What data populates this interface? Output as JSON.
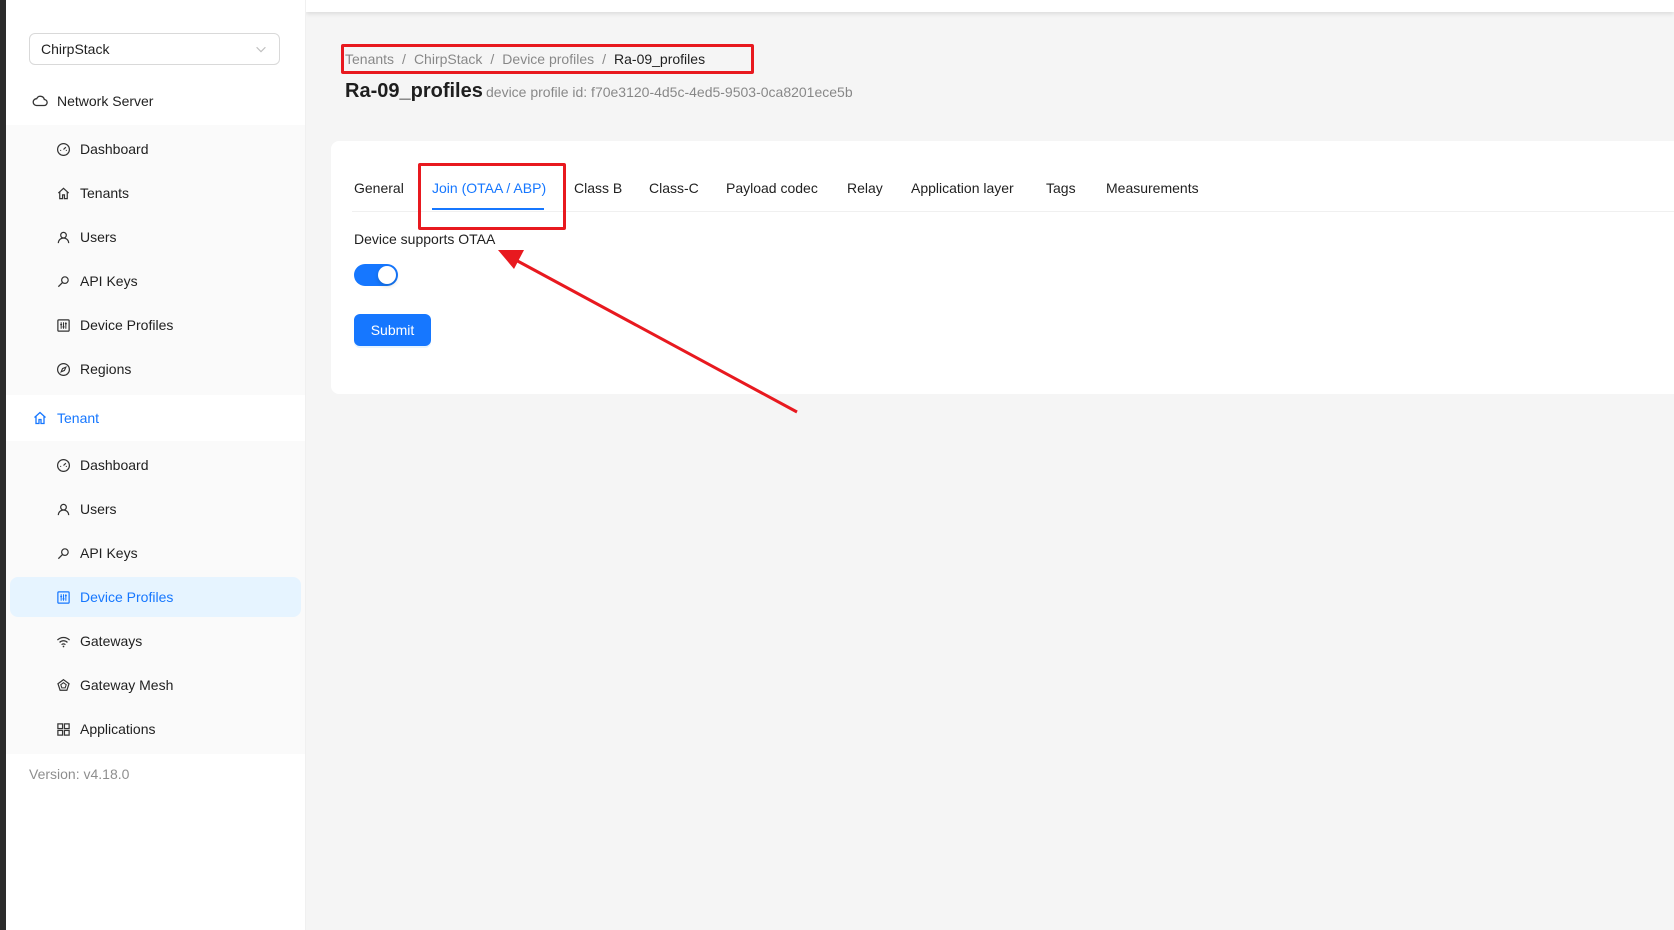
{
  "sidebar": {
    "tenant_select": "ChirpStack",
    "network_server": {
      "title": "Network Server",
      "items": [
        {
          "label": "Dashboard",
          "icon": "dashboard-icon"
        },
        {
          "label": "Tenants",
          "icon": "home-icon"
        },
        {
          "label": "Users",
          "icon": "user-icon"
        },
        {
          "label": "API Keys",
          "icon": "key-icon"
        },
        {
          "label": "Device Profiles",
          "icon": "control-icon"
        },
        {
          "label": "Regions",
          "icon": "compass-icon"
        }
      ]
    },
    "tenant": {
      "title": "Tenant",
      "items": [
        {
          "label": "Dashboard",
          "icon": "dashboard-icon"
        },
        {
          "label": "Users",
          "icon": "user-icon"
        },
        {
          "label": "API Keys",
          "icon": "key-icon"
        },
        {
          "label": "Device Profiles",
          "icon": "control-icon",
          "selected": true
        },
        {
          "label": "Gateways",
          "icon": "wifi-icon"
        },
        {
          "label": "Gateway Mesh",
          "icon": "radar-icon"
        },
        {
          "label": "Applications",
          "icon": "appstore-icon"
        }
      ]
    },
    "version": "Version: v4.18.0"
  },
  "breadcrumb": [
    "Tenants",
    "ChirpStack",
    "Device profiles",
    "Ra-09_profiles"
  ],
  "page": {
    "title": "Ra-09_profiles",
    "subtitle": "device profile id: f70e3120-4d5c-4ed5-9503-0ca8201ece5b"
  },
  "tabs": [
    {
      "label": "General"
    },
    {
      "label": "Join (OTAA / ABP)",
      "active": true
    },
    {
      "label": "Class B"
    },
    {
      "label": "Class-C"
    },
    {
      "label": "Payload codec"
    },
    {
      "label": "Relay"
    },
    {
      "label": "Application layer"
    },
    {
      "label": "Tags"
    },
    {
      "label": "Measurements"
    }
  ],
  "form": {
    "otaa_label": "Device supports OTAA",
    "otaa_enabled": true,
    "submit_label": "Submit"
  },
  "colors": {
    "primary": "#1677ff",
    "annotation": "#e8191f"
  }
}
